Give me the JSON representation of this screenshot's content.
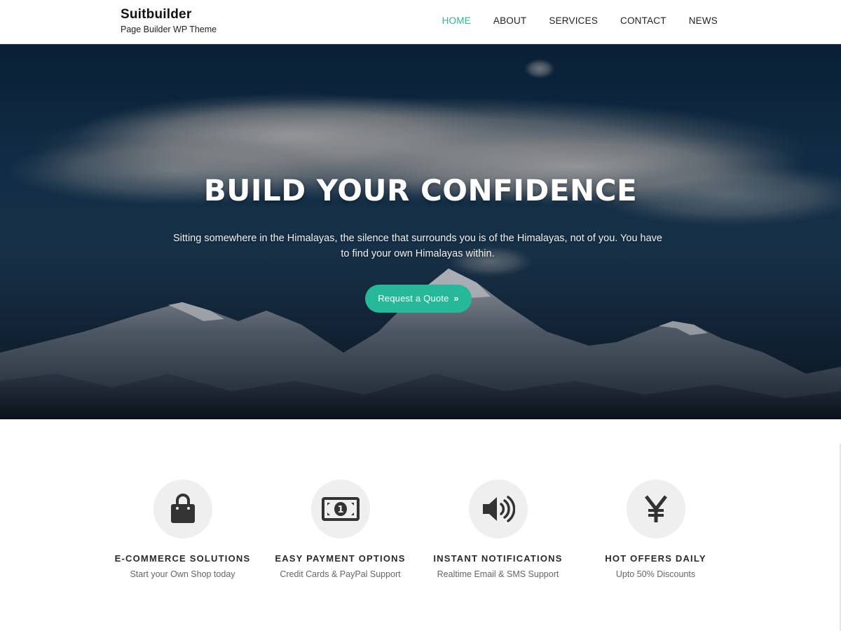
{
  "header": {
    "site_title": "Suitbuilder",
    "tagline": "Page Builder WP Theme",
    "nav": [
      {
        "label": "HOME",
        "active": true
      },
      {
        "label": "ABOUT",
        "active": false
      },
      {
        "label": "SERVICES",
        "active": false
      },
      {
        "label": "CONTACT",
        "active": false
      },
      {
        "label": "NEWS",
        "active": false
      }
    ]
  },
  "hero": {
    "title": "BUILD YOUR CONFIDENCE",
    "text": "Sitting somewhere in the Himalayas, the silence that surrounds you is of the Himalayas, not of you. You have to find your own Himalayas within.",
    "button_label": "Request a Quote",
    "button_icon": "double-chevron-right-icon"
  },
  "features": [
    {
      "icon": "shopping-bag-icon",
      "title": "E-COMMERCE SOLUTIONS",
      "subtitle": "Start your Own Shop today"
    },
    {
      "icon": "money-bill-icon",
      "title": "EASY PAYMENT OPTIONS",
      "subtitle": "Credit Cards & PayPal Support"
    },
    {
      "icon": "volume-up-icon",
      "title": "INSTANT NOTIFICATIONS",
      "subtitle": "Realtime Email & SMS Support"
    },
    {
      "icon": "yen-icon",
      "title": "HOT OFFERS DAILY",
      "subtitle": "Upto 50% Discounts"
    }
  ],
  "colors": {
    "accent": "#2cb59a",
    "button": "#25b99a",
    "icon_circle": "#efefef",
    "icon": "#333333"
  }
}
